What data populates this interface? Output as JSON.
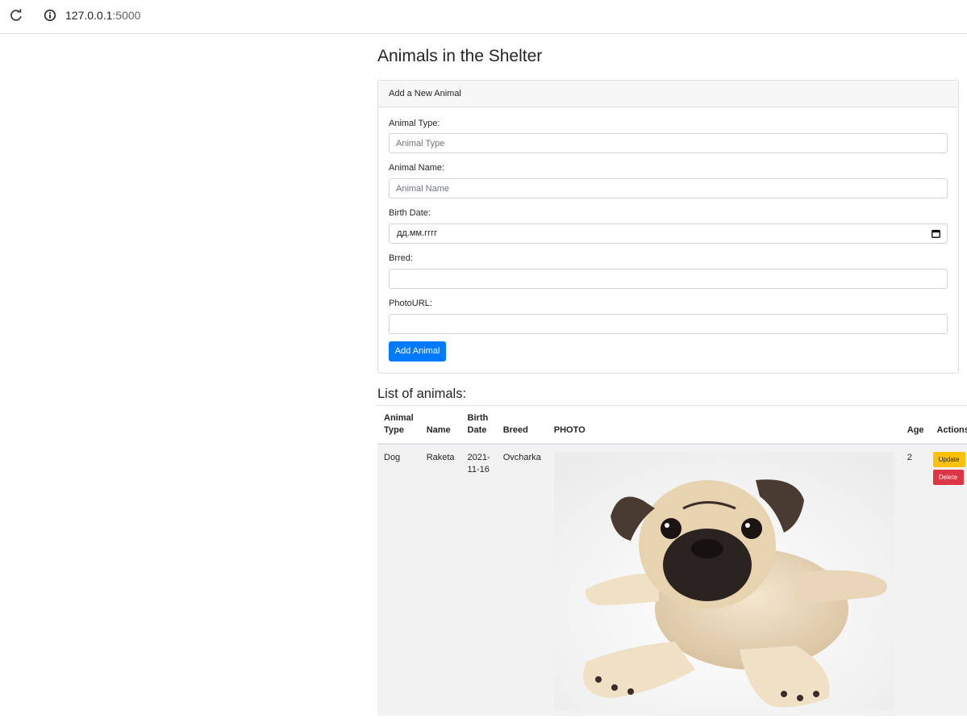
{
  "browser": {
    "url_host": "127.0.0.1",
    "url_port": ":5000"
  },
  "page": {
    "title": "Animals in the Shelter"
  },
  "form": {
    "header": "Add a New Animal",
    "type_label": "Animal Type:",
    "type_placeholder": "Animal Type",
    "name_label": "Animal Name:",
    "name_placeholder": "Animal Name",
    "birth_label": "Birth Date:",
    "birth_placeholder": "дд.мм.гггг",
    "breed_label": "Brred:",
    "photo_label": "PhotoURL:",
    "submit_label": "Add Animal"
  },
  "list": {
    "title": "List of animals:",
    "columns": [
      "Animal Type",
      "Name",
      "Birth Date",
      "Breed",
      "PHOTO",
      "Age",
      "Actions"
    ],
    "rows": [
      {
        "type": "Dog",
        "name": "Raketa",
        "birth_date": "2021-11-16",
        "breed": "Ovcharka",
        "photo": "pug-photo",
        "age": "2",
        "update_label": "Update",
        "delete_label": "Delete"
      }
    ]
  },
  "colors": {
    "primary": "#007bff",
    "warning": "#ffc107",
    "danger": "#dc3545"
  }
}
